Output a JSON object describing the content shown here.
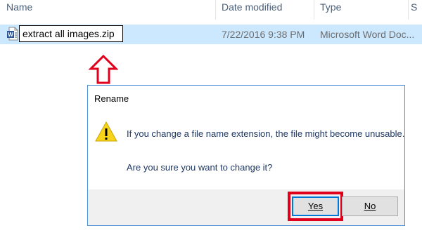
{
  "columns": {
    "name": "Name",
    "date_modified": "Date modified",
    "type": "Type",
    "size_partial": "S"
  },
  "file": {
    "rename_value": "extract all images.zip",
    "date": "7/22/2016 9:38 PM",
    "type": "Microsoft Word Doc...",
    "icon": "word-document-icon"
  },
  "dialog": {
    "title": "Rename",
    "message": "If you change a file name extension, the file might become unusable.",
    "question": "Are you sure you want to change it?",
    "yes_label": "Yes",
    "no_label": "No",
    "icon": "warning-icon"
  },
  "annotation": {
    "arrow_color": "#e0001b",
    "highlight_color": "#e0001b"
  }
}
